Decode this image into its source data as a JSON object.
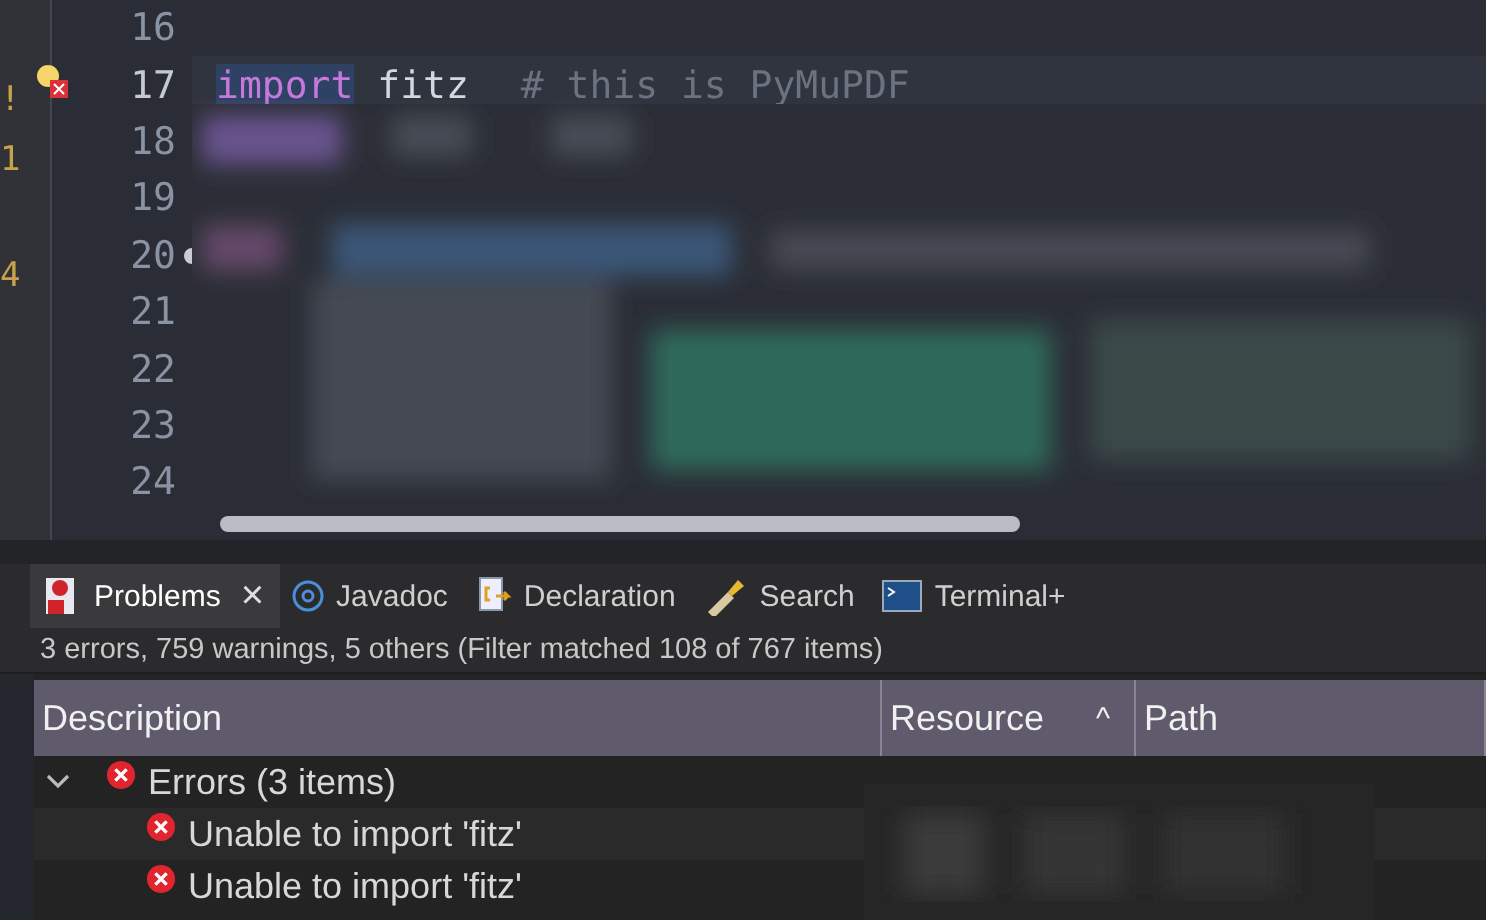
{
  "overview_marks": [
    "!",
    "1",
    "4"
  ],
  "editor": {
    "lines": [
      {
        "number": "16",
        "current": false,
        "marker": false
      },
      {
        "number": "17",
        "tokens": [
          {
            "kind": "keyword",
            "text": "import",
            "selected": true
          },
          {
            "kind": "name",
            "text": "fitz",
            "selected": false
          },
          {
            "kind": "comment",
            "text": "# this is PyMuPDF",
            "selected": false
          }
        ],
        "current": true,
        "marker": true
      },
      {
        "number": "18",
        "current": false,
        "marker": false
      },
      {
        "number": "19",
        "current": false,
        "marker": false
      },
      {
        "number": "20",
        "current": false,
        "marker": false,
        "fold": true
      },
      {
        "number": "21",
        "current": false,
        "marker": false
      },
      {
        "number": "22",
        "current": false,
        "marker": false
      },
      {
        "number": "23",
        "current": false,
        "marker": false
      },
      {
        "number": "24",
        "current": false,
        "marker": false
      }
    ]
  },
  "tabs": [
    {
      "label": "Problems",
      "kind": "problems",
      "selected": true,
      "closable": true
    },
    {
      "label": "Javadoc",
      "kind": "javadoc",
      "selected": false,
      "closable": false
    },
    {
      "label": "Declaration",
      "kind": "declaration",
      "selected": false,
      "closable": false
    },
    {
      "label": "Search",
      "kind": "search",
      "selected": false,
      "closable": false
    },
    {
      "label": "Terminal+",
      "kind": "terminal",
      "selected": false,
      "closable": false
    }
  ],
  "close_glyph": "×",
  "summary": "3 errors, 759 warnings, 5 others (Filter matched 108 of 767 items)",
  "table": {
    "columns": [
      {
        "label": "Description"
      },
      {
        "label": "Resource",
        "sort": "^"
      },
      {
        "label": "Path"
      }
    ],
    "rows": [
      {
        "kind": "group",
        "text": "Errors (3 items)",
        "expanded": true
      },
      {
        "kind": "error",
        "text": "Unable to import 'fitz'"
      },
      {
        "kind": "error",
        "text": "Unable to import 'fitz'"
      }
    ]
  }
}
